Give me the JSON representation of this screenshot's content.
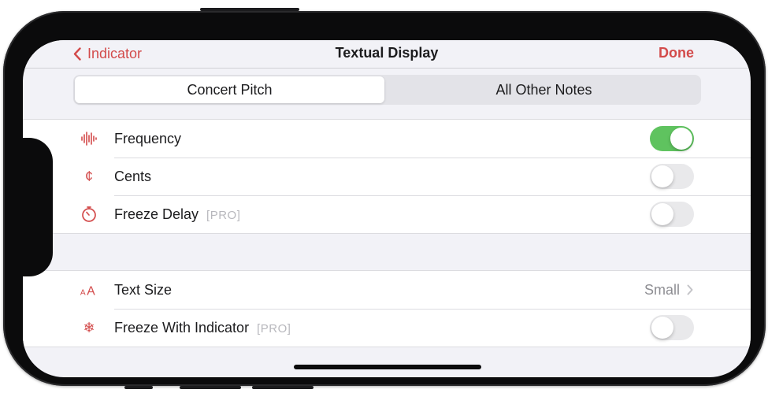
{
  "nav": {
    "back_label": "Indicator",
    "title": "Textual Display",
    "done_label": "Done"
  },
  "segments": [
    {
      "label": "Concert Pitch",
      "selected": true
    },
    {
      "label": "All Other Notes",
      "selected": false
    }
  ],
  "group1": {
    "rows": [
      {
        "icon": "waveform-icon",
        "label": "Frequency",
        "pro": "",
        "toggle": true
      },
      {
        "icon": "cent-sign-icon",
        "icon_glyph": "¢",
        "label": "Cents",
        "pro": "",
        "toggle": false
      },
      {
        "icon": "timer-icon",
        "label": "Freeze Delay",
        "pro": "[PRO]",
        "toggle": false
      }
    ]
  },
  "group2": {
    "rows": [
      {
        "icon": "text-size-icon",
        "icon_glyph": "AA",
        "label": "Text Size",
        "value": "Small"
      },
      {
        "icon": "snowflake-icon",
        "icon_glyph": "❄",
        "label": "Freeze With Indicator",
        "pro": "[PRO]",
        "toggle": false
      }
    ]
  },
  "colors": {
    "accent": "#d34b4b",
    "toggle_on": "#5fc35f",
    "background": "#f2f2f7"
  }
}
